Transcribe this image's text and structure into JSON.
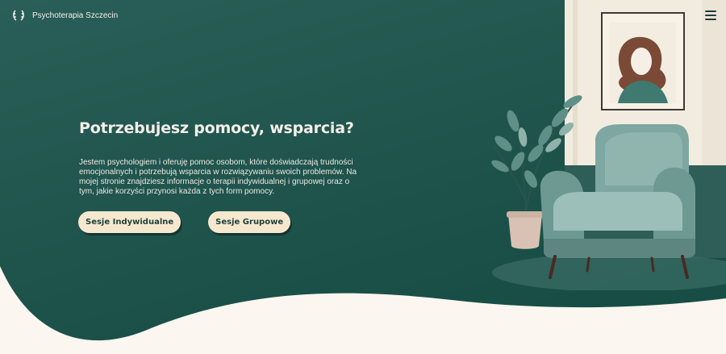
{
  "header": {
    "brand_name": "Psychoterapia Szczecin",
    "logo_icon": "laurel-wreath-icon",
    "menu_icon": "hamburger-menu-icon"
  },
  "hero": {
    "title": "Potrzebujesz pomocy, wsparcia?",
    "description": "Jestem psychologiem i oferuję pomoc osobom, które doświadczają trudności emocjonalnych i potrzebują wsparcia w rozwiązywaniu swoich problemów. Na mojej stronie znajdziesz informacje o terapii indywidualnej i grupowej oraz o tym, jakie korzyści przynosi każda z tych form pomocy.",
    "buttons": [
      {
        "label": "Sesje Indywidualne"
      },
      {
        "label": "Sesje Grupowe"
      }
    ]
  },
  "colors": {
    "hero_bg_top": "#2a5e58",
    "hero_bg_bottom": "#174d45",
    "page_bg": "#fbf6f0",
    "button_bg": "#f6e8cf",
    "button_text": "#1f3f3a"
  }
}
